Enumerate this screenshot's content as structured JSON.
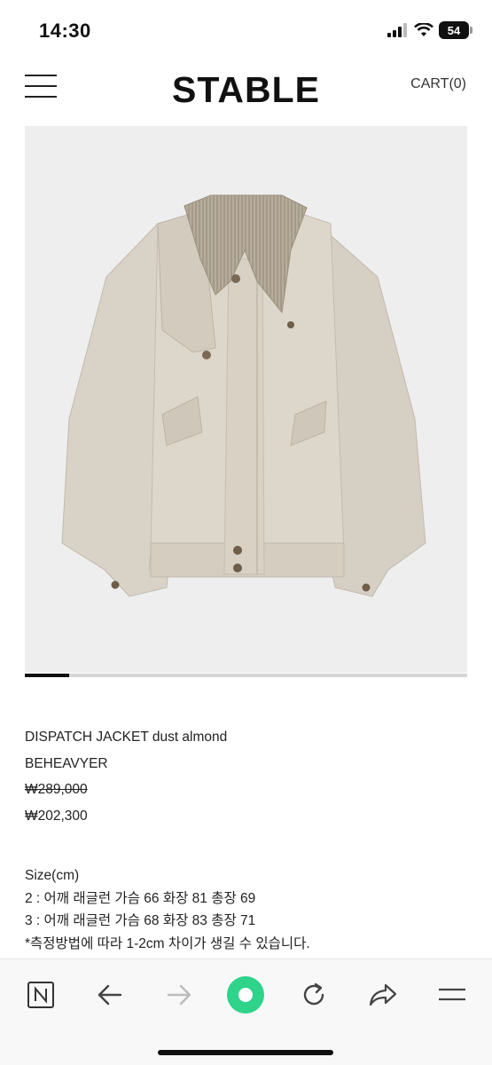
{
  "status_bar": {
    "time": "14:30",
    "battery": "54"
  },
  "header": {
    "brand": "STABLE",
    "cart_label": "CART(0)"
  },
  "product": {
    "image_icon": "jacket-photo",
    "slider_progress": 0.1,
    "name": "DISPATCH JACKET dust almond",
    "brand": "BEHEAVYER",
    "original_price": "₩289,000",
    "sale_price": "₩202,300"
  },
  "size_info": {
    "heading": "Size(cm)",
    "lines": [
      "2 : 어깨 래글런 가슴 66 화장 81 총장 69",
      "3 : 어깨 래글런 가슴 68 화장 83 총장 71",
      "*측정방법에 따라 1-2cm 차이가 생길 수 있습니다."
    ]
  },
  "browser_toolbar": {
    "icons": [
      "naver-icon",
      "back-arrow-icon",
      "forward-arrow-icon",
      "green-dot-icon",
      "refresh-icon",
      "share-icon",
      "menu-lines-icon"
    ],
    "accent_color": "#2fd38a"
  }
}
